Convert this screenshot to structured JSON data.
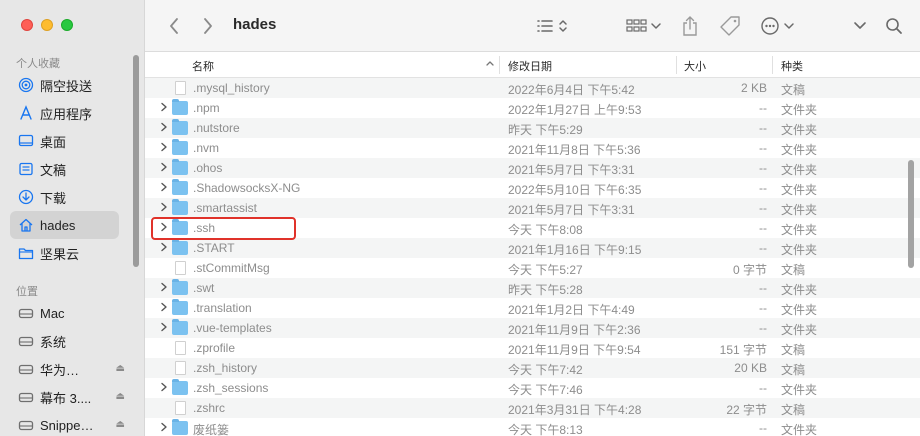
{
  "window": {
    "title": "hades"
  },
  "sidebar": {
    "favorites_header": "个人收藏",
    "favorites": [
      {
        "label": "隔空投送",
        "icon": "airdrop-icon"
      },
      {
        "label": "应用程序",
        "icon": "applications-icon"
      },
      {
        "label": "桌面",
        "icon": "desktop-icon"
      },
      {
        "label": "文稿",
        "icon": "documents-icon"
      },
      {
        "label": "下载",
        "icon": "downloads-icon"
      },
      {
        "label": "hades",
        "icon": "home-icon",
        "active": true
      },
      {
        "label": "坚果云",
        "icon": "folder-icon"
      }
    ],
    "locations_header": "位置",
    "locations": [
      {
        "label": "Mac",
        "icon": "disk-icon"
      },
      {
        "label": "系统",
        "icon": "disk-icon"
      },
      {
        "label": "华为…",
        "icon": "disk-icon",
        "eject": true
      },
      {
        "label": "幕布 3....",
        "icon": "disk-icon",
        "eject": true
      },
      {
        "label": "Snippe…",
        "icon": "disk-icon",
        "eject": true
      }
    ],
    "eject_glyph": "⏏"
  },
  "columns": {
    "name": "名称",
    "date": "修改日期",
    "size": "大小",
    "kind": "种类"
  },
  "files": [
    {
      "name": ".mysql_history",
      "date": "2022年6月4日 下午5:42",
      "size": "2 KB",
      "kind": "文稿",
      "type": "doc"
    },
    {
      "name": ".npm",
      "date": "2022年1月27日 上午9:53",
      "size": "--",
      "kind": "文件夹",
      "type": "folder"
    },
    {
      "name": ".nutstore",
      "date": "昨天 下午5:29",
      "size": "--",
      "kind": "文件夹",
      "type": "folder"
    },
    {
      "name": ".nvm",
      "date": "2021年11月8日 下午5:36",
      "size": "--",
      "kind": "文件夹",
      "type": "folder"
    },
    {
      "name": ".ohos",
      "date": "2021年5月7日 下午3:31",
      "size": "--",
      "kind": "文件夹",
      "type": "folder"
    },
    {
      "name": ".ShadowsocksX-NG",
      "date": "2022年5月10日 下午6:35",
      "size": "--",
      "kind": "文件夹",
      "type": "folder"
    },
    {
      "name": ".smartassist",
      "date": "2021年5月7日 下午3:31",
      "size": "--",
      "kind": "文件夹",
      "type": "folder"
    },
    {
      "name": ".ssh",
      "date": "今天 下午8:08",
      "size": "--",
      "kind": "文件夹",
      "type": "folder"
    },
    {
      "name": ".START",
      "date": "2021年1月16日 下午9:15",
      "size": "--",
      "kind": "文件夹",
      "type": "folder"
    },
    {
      "name": ".stCommitMsg",
      "date": "今天 下午5:27",
      "size": "0 字节",
      "kind": "文稿",
      "type": "doc"
    },
    {
      "name": ".swt",
      "date": "昨天 下午5:28",
      "size": "--",
      "kind": "文件夹",
      "type": "folder"
    },
    {
      "name": ".translation",
      "date": "2021年1月2日 下午4:49",
      "size": "--",
      "kind": "文件夹",
      "type": "folder"
    },
    {
      "name": ".vue-templates",
      "date": "2021年11月9日 下午2:36",
      "size": "--",
      "kind": "文件夹",
      "type": "folder"
    },
    {
      "name": ".zprofile",
      "date": "2021年11月9日 下午9:54",
      "size": "151 字节",
      "kind": "文稿",
      "type": "doc"
    },
    {
      "name": ".zsh_history",
      "date": "今天 下午7:42",
      "size": "20 KB",
      "kind": "文稿",
      "type": "doc"
    },
    {
      "name": ".zsh_sessions",
      "date": "今天 下午7:46",
      "size": "--",
      "kind": "文件夹",
      "type": "folder"
    },
    {
      "name": ".zshrc",
      "date": "2021年3月31日 下午4:28",
      "size": "22 字节",
      "kind": "文稿",
      "type": "doc"
    },
    {
      "name": "废纸篓",
      "date": "今天 下午8:13",
      "size": "--",
      "kind": "文件夹",
      "type": "folder"
    }
  ],
  "disclosure_glyph": "›",
  "sort_glyph": "⌃",
  "colors": {
    "accent": "#1976f0",
    "highlight": "#e0322a",
    "folder": "#7cc2f0"
  }
}
